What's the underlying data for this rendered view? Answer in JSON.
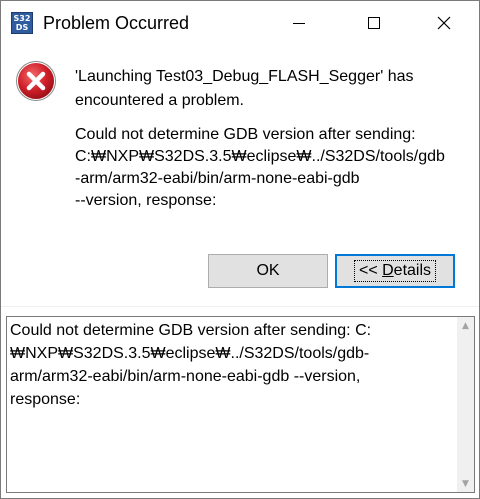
{
  "window": {
    "title": "Problem Occurred",
    "icon_text": [
      "S32",
      "DS"
    ]
  },
  "title_bar": {
    "minimize_icon": "minimize-icon",
    "maximize_icon": "maximize-icon",
    "close_icon": "close-icon"
  },
  "message": {
    "icon": "error-icon",
    "title_lines": [
      "'Launching Test03_Debug_FLASH_Segger' has",
      "encountered a problem."
    ],
    "body_lines": [
      "Could not determine GDB version after sending:",
      "C:₩NXP₩S32DS.3.5₩eclipse₩../S32DS/tools/gdb",
      "-arm/arm32-eabi/bin/arm-none-eabi-gdb",
      "--version, response:"
    ]
  },
  "buttons": {
    "ok_label": "OK",
    "details_label": "<< Details"
  },
  "details": {
    "lines": [
      "Could not determine GDB version after sending: C:",
      "₩NXP₩S32DS.3.5₩eclipse₩../S32DS/tools/gdb-",
      "arm/arm32-eabi/bin/arm-none-eabi-gdb --version,",
      "response:"
    ]
  },
  "colors": {
    "error_red": "#d0202a",
    "focus_blue": "#0078d7",
    "button_bg": "#e1e1e1"
  }
}
